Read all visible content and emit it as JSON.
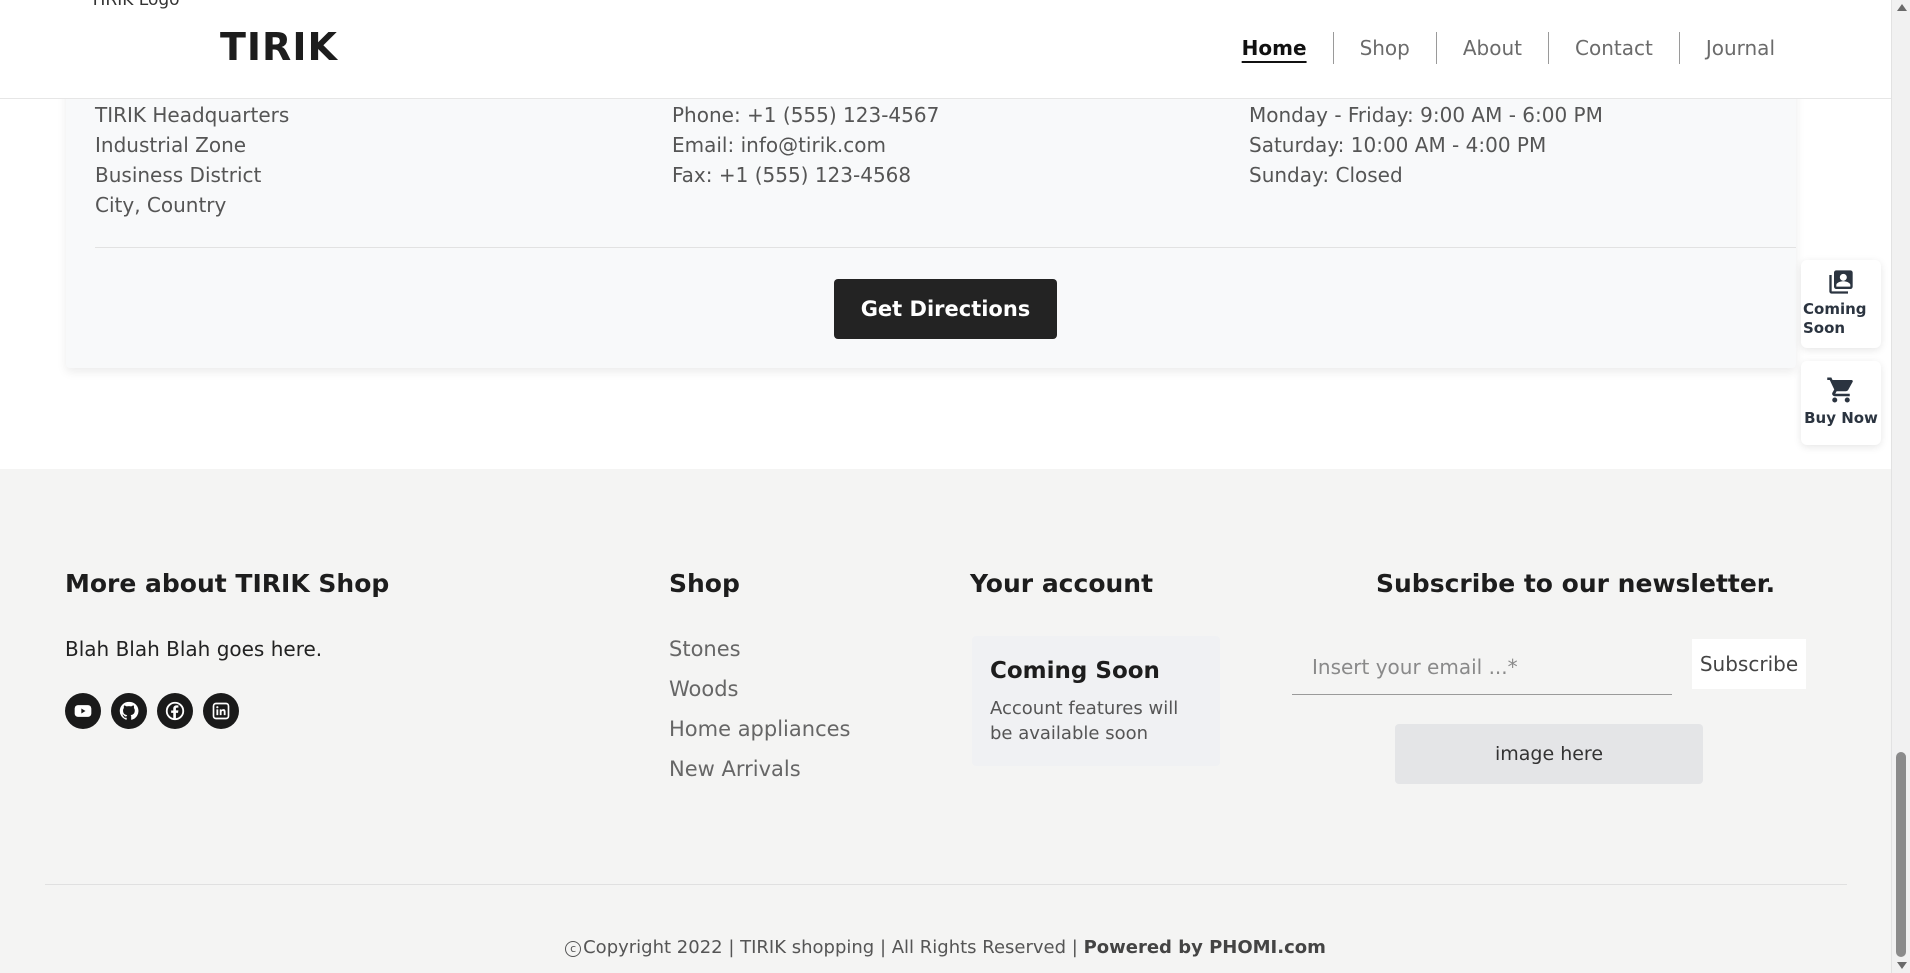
{
  "header": {
    "logo_alt_text": "TIRIK Logo",
    "logo_text": "TIRIK",
    "nav": [
      {
        "label": "Home",
        "active": true
      },
      {
        "label": "Shop",
        "active": false
      },
      {
        "label": "About",
        "active": false
      },
      {
        "label": "Contact",
        "active": false
      },
      {
        "label": "Journal",
        "active": false
      }
    ]
  },
  "contact_card": {
    "address_lines": [
      "TIRIK Headquarters",
      "Industrial Zone",
      "Business District",
      "City, Country"
    ],
    "contact_lines": [
      "Phone: +1 (555) 123-4567",
      "Email: info@tirik.com",
      "Fax: +1 (555) 123-4568"
    ],
    "hours_lines": [
      "Monday - Friday: 9:00 AM - 6:00 PM",
      "Saturday: 10:00 AM - 4:00 PM",
      "Sunday: Closed"
    ],
    "directions_button": "Get Directions"
  },
  "floating": {
    "coming_soon_label": "Coming Soon",
    "coming_soon_icon": "account-box-icon",
    "buy_now_label": "Buy Now",
    "buy_now_icon": "cart-icon"
  },
  "footer": {
    "about_heading": "More about TIRIK Shop",
    "about_text": "Blah Blah Blah goes here.",
    "socials": [
      "youtube-icon",
      "github-icon",
      "facebook-icon",
      "linkedin-icon"
    ],
    "shop_heading": "Shop",
    "shop_links": [
      "Stones",
      "Woods",
      "Home appliances",
      "New Arrivals"
    ],
    "account_heading": "Your account",
    "account_box_title": "Coming Soon",
    "account_box_text": "Account features will be available soon",
    "newsletter_heading": "Subscribe to our newsletter.",
    "email_placeholder": "Insert your email ...*",
    "subscribe_label": "Subscribe",
    "image_placeholder": "image here",
    "copyright_text": "Copyright 2022 | TIRIK shopping | All Rights Reserved | ",
    "powered_by": "Powered by PHOMI.com"
  }
}
